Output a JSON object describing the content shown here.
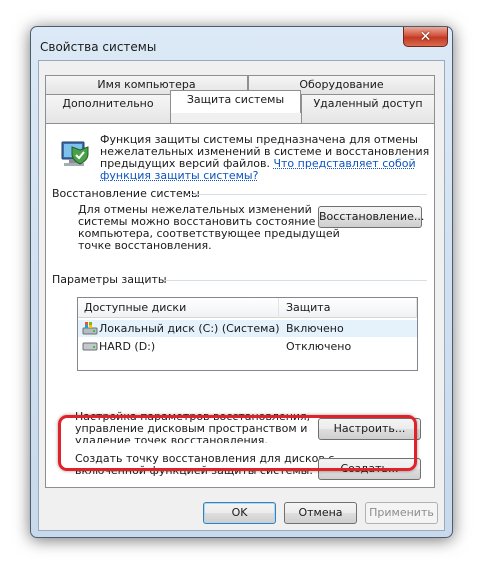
{
  "window": {
    "title": "Свойства системы",
    "close_glyph": "✕"
  },
  "tabs": {
    "row1": [
      "Имя компьютера",
      "Оборудование"
    ],
    "row2": [
      "Дополнительно",
      "Защита системы",
      "Удаленный доступ"
    ],
    "active": "Защита системы"
  },
  "intro": {
    "line1": "Функция защиты системы предназначена для отмены",
    "line2": "нежелательных изменений в системе и восстановления",
    "line3": "предыдущих версий файлов.",
    "link1": "Что представляет собой",
    "link2": "функция защиты системы?"
  },
  "restore": {
    "header": "Восстановление системы",
    "line1": "Для отмены нежелательных изменений",
    "line2": "системы можно восстановить состояние",
    "line3": "компьютера, соответствующее предыдущей",
    "line4": "точке восстановления.",
    "button": "Восстановление..."
  },
  "protection": {
    "header": "Параметры защиты",
    "columns": [
      "Доступные диски",
      "Защита"
    ],
    "rows": [
      {
        "disk": "Локальный диск (C:) (Система)",
        "status": "Включено",
        "icon": "system-drive-icon"
      },
      {
        "disk": "HARD (D:)",
        "status": "Отключено",
        "icon": "drive-icon"
      }
    ]
  },
  "configure": {
    "line1": "Настройка параметров восстановления,",
    "line2": "управление дисковым пространством и",
    "line3": "удаление точек восстановления.",
    "button": "Настроить..."
  },
  "create": {
    "line1": "Создать точку восстановления для дисков с",
    "line2": "включенной функцией защиты системы.",
    "button": "Создать..."
  },
  "footer": {
    "ok": "OK",
    "cancel": "Отмена",
    "apply": "Применить"
  },
  "colors": {
    "highlight": "#e02229",
    "link": "#0b54c1"
  }
}
